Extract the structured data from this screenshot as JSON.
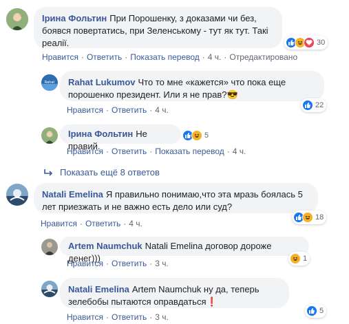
{
  "comments": [
    {
      "author": "Ірина Фольтин",
      "text": "При Порошенку, з доказами чи без, боявся повертатись, при Зеленському - тут як тут. Такі реалії.",
      "reactions_count": "30",
      "actions": {
        "like": "Нравится",
        "reply": "Ответить",
        "translate": "Показать перевод",
        "time": "4 ч.",
        "edited": "Отредактировано"
      }
    },
    {
      "author": "Rahat Lukumov",
      "text": "Что то мне «кажется» что пока еще порошенко президент. Или я не прав?😎",
      "reactions_count": "22",
      "actions": {
        "like": "Нравится",
        "reply": "Ответить",
        "time": "4 ч."
      }
    },
    {
      "author": "Ірина Фольтин",
      "text": "Не правий.",
      "reactions_count": "5",
      "actions": {
        "like": "Нравится",
        "reply": "Ответить",
        "translate": "Показать перевод",
        "time": "4 ч."
      }
    },
    {
      "more_replies_label": "Показать ещё 8 ответов"
    },
    {
      "author": "Natali Emelina",
      "text": "Я правильно понимаю,что эта мразь боялась 5 лет приезжать и не важно есть дело или суд?",
      "reactions_count": "18",
      "actions": {
        "like": "Нравится",
        "reply": "Ответить",
        "time": "4 ч."
      }
    },
    {
      "author": "Artem Naumchuk",
      "text": "Natali Emelina договор дороже денег)))",
      "reactions_count": "1",
      "actions": {
        "like": "Нравится",
        "reply": "Ответить",
        "time": "3 ч."
      }
    },
    {
      "author": "Natali Emelina",
      "text": "Artem Naumchuk ну да, теперь зелебобы пытаются оправдаться❗",
      "reactions_count": "5",
      "actions": {
        "like": "Нравится",
        "reply": "Ответить",
        "time": "3 ч."
      }
    }
  ],
  "colors": {
    "link": "#385898",
    "meta": "#606770",
    "bubble": "#f2f3f5",
    "like": "#1877f2",
    "haha": "#f7b125",
    "love": "#f33e58"
  }
}
